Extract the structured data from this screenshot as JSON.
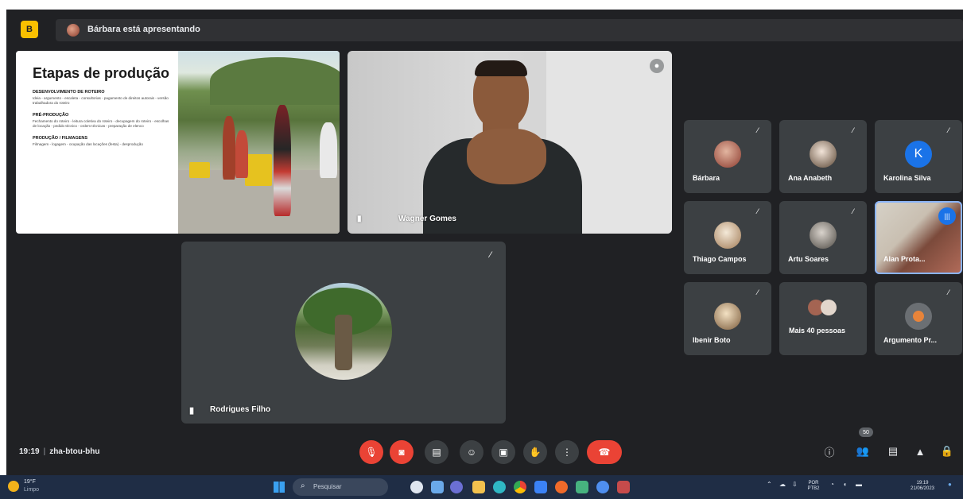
{
  "presenting": {
    "logo_text": "B",
    "text": "Bárbara está apresentando"
  },
  "slide": {
    "title": "Etapas de produção",
    "sections": [
      {
        "title": "DESENVOLVIMENTO DE ROTEIRO",
        "body": "Ideia - argumento - escaleta - consultorias - pagamento de direitos autorais - versão trabalhadora do roteiro"
      },
      {
        "title": "PRÉ-PRODUÇÃO",
        "body": "Fechamento do roteiro - leitura coletiva do roteiro - decupagem do roteiro - escolhas de locação - pedido técnico - ordem técnicas - preparação de elenco"
      },
      {
        "title": "PRODUÇÃO / FILMAGENS",
        "body": "Filmagem - logagem - ocupação das locações (festa) - desprodução"
      }
    ]
  },
  "interpreter": {
    "name": "Wagner Gomes"
  },
  "main_tile": {
    "name": "Rodrigues Filho"
  },
  "participants": [
    {
      "name": "Bárbara",
      "avatar": "photo"
    },
    {
      "name": "Ana Anabeth",
      "avatar": "photo"
    },
    {
      "name": "Karolina Silva",
      "avatar": "letter",
      "initial": "K"
    },
    {
      "name": "Thiago Campos",
      "avatar": "photo"
    },
    {
      "name": "Artu Soares",
      "avatar": "photo"
    },
    {
      "name": "Alan Prota...",
      "avatar": "video",
      "speaking": true
    },
    {
      "name": "Ibenir Boto",
      "avatar": "photo"
    },
    {
      "name": "Mais 40 pessoas",
      "avatar": "group"
    },
    {
      "name": "Argumento Pr...",
      "avatar": "logo"
    }
  ],
  "bottom_bar": {
    "time": "19:19",
    "separator": "|",
    "meeting_code": "zha-btou-bhu",
    "people_count": "50"
  },
  "taskbar": {
    "weather_temp": "19°F",
    "weather_desc": "Limpo",
    "search_placeholder": "Pesquisar",
    "lang_top": "POR",
    "lang_bottom": "PTB2",
    "clock_time": "19:19",
    "clock_date": "21/06/2023"
  },
  "colors": {
    "meet_background": "#202124",
    "tile": "#3c4043",
    "danger": "#ea4335",
    "accent": "#1a73e8",
    "taskbar": "#1f2d45"
  }
}
